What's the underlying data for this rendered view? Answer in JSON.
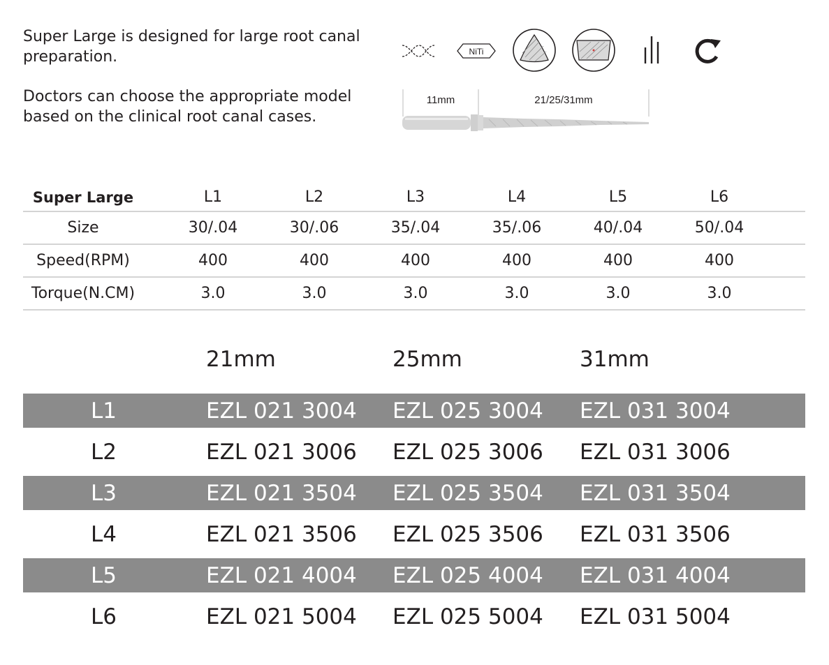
{
  "intro": {
    "line1": "Super Large is designed for large root canal preparation.",
    "line2": "Doctors can choose the appropriate model based on the clinical root canal cases."
  },
  "icons": [
    {
      "name": "helix-icon"
    },
    {
      "name": "niti-icon",
      "label": "NiTi"
    },
    {
      "name": "triangular-cross-section-icon"
    },
    {
      "name": "square-cross-section-icon"
    },
    {
      "name": "three-files-icon"
    },
    {
      "name": "rotation-icon"
    }
  ],
  "diagram": {
    "handle_length": "11mm",
    "blade_length": "21/25/31mm"
  },
  "spec_table": {
    "header": {
      "label": "Super Large",
      "models": [
        "L1",
        "L2",
        "L3",
        "L4",
        "L5",
        "L6"
      ]
    },
    "rows": [
      {
        "label": "Size",
        "values": [
          "30/.04",
          "30/.06",
          "35/.04",
          "35/.06",
          "40/.04",
          "50/.04"
        ]
      },
      {
        "label": "Speed(RPM)",
        "values": [
          "400",
          "400",
          "400",
          "400",
          "400",
          "400"
        ]
      },
      {
        "label": "Torque(N.CM)",
        "values": [
          "3.0",
          "3.0",
          "3.0",
          "3.0",
          "3.0",
          "3.0"
        ]
      }
    ]
  },
  "code_table": {
    "lengths": [
      "21mm",
      "25mm",
      "31mm"
    ],
    "rows": [
      {
        "model": "L1",
        "codes": [
          "EZL 021 3004",
          "EZL 025 3004",
          "EZL 031 3004"
        ]
      },
      {
        "model": "L2",
        "codes": [
          "EZL 021 3006",
          "EZL 025 3006",
          "EZL 031 3006"
        ]
      },
      {
        "model": "L3",
        "codes": [
          "EZL 021 3504",
          "EZL 025 3504",
          "EZL 031 3504"
        ]
      },
      {
        "model": "L4",
        "codes": [
          "EZL 021 3506",
          "EZL 025 3506",
          "EZL 031 3506"
        ]
      },
      {
        "model": "L5",
        "codes": [
          "EZL 021 4004",
          "EZL 025 4004",
          "EZL 031 4004"
        ]
      },
      {
        "model": "L6",
        "codes": [
          "EZL 021 5004",
          "EZL 025 5004",
          "EZL 031 5004"
        ]
      }
    ],
    "shade_color": "#8b8b8b"
  }
}
